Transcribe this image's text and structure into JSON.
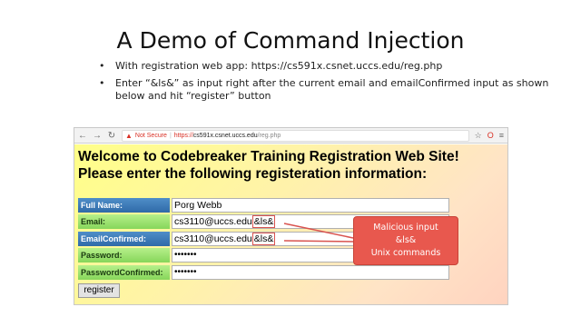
{
  "slide": {
    "title": "A Demo of Command  Injection",
    "bullets": [
      "With registration web app: https://cs591x.csnet.uccs.edu/reg.php",
      "Enter “&ls&” as input right after the current  email and emailConfirmed input as shown below and hit “register” button"
    ]
  },
  "browser": {
    "back_icon": "←",
    "forward_icon": "→",
    "reload_icon": "↻",
    "not_secure": "Not Secure",
    "url_scheme": "https://",
    "url_host": "cs591x.csnet.uccs.edu",
    "url_path": "/reg.php",
    "star_icon": "☆",
    "opera_icon": "O",
    "menu_icon": "≡"
  },
  "page": {
    "heading_line1": "Welcome to Codebreaker Training Registration Web Site!",
    "heading_line2": "Please enter the following registeration information:",
    "fields": {
      "full_name": {
        "label": "Full Name:",
        "value": "Porg Webb"
      },
      "email": {
        "label": "Email:",
        "value": "cs3110@uccs.edu",
        "injected": "&ls&"
      },
      "email_confirmed": {
        "label": "EmailConfirmed:",
        "value": "cs3110@uccs.edu",
        "injected": "&ls&"
      },
      "password": {
        "label": "Password:",
        "value": "•••••••"
      },
      "password_confirmed": {
        "label": "PasswordConfirmed:",
        "value": "•••••••"
      }
    },
    "register_label": "register"
  },
  "callout": {
    "line1": "Malicious input",
    "line2": "&ls&",
    "line3": "Unix commands",
    "color": "#e8584e"
  }
}
